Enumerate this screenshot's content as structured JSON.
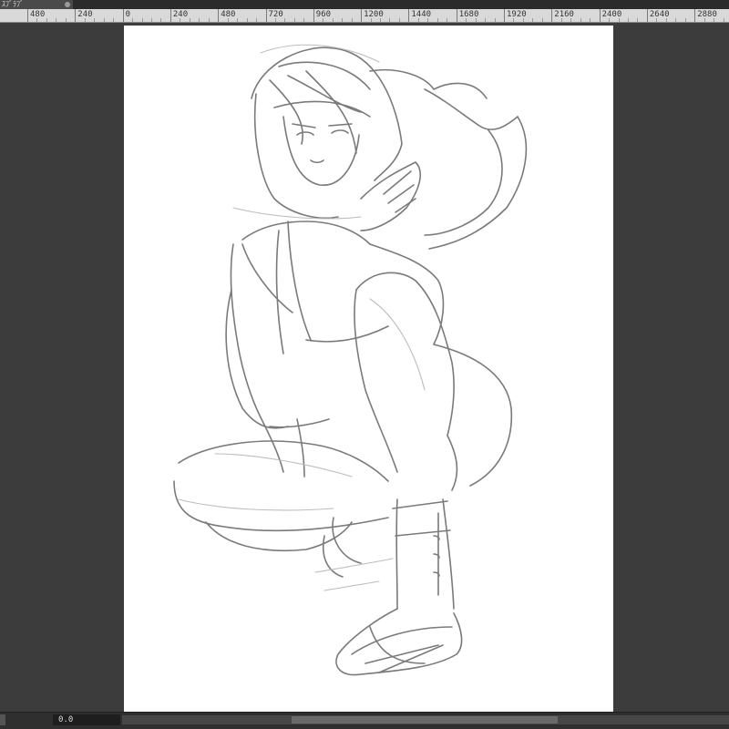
{
  "tab": {
    "title": "ｽﾅｯﾌﾟｼｮｯﾄｽﾌﾞｽﾌﾞｽﾌﾞｽﾌﾞﾗ",
    "short": "ｽﾌﾞﾗﾌﾞ"
  },
  "ruler": {
    "labels": [
      "480",
      "240",
      "0",
      "240",
      "480",
      "720",
      "960",
      "1200",
      "1440",
      "1680",
      "1920",
      "2160",
      "2400",
      "2640",
      "2880"
    ]
  },
  "status": {
    "angle": "0.0"
  },
  "artwork": {
    "subject": "pencil sketch of a crouching figure in a hoodie"
  }
}
